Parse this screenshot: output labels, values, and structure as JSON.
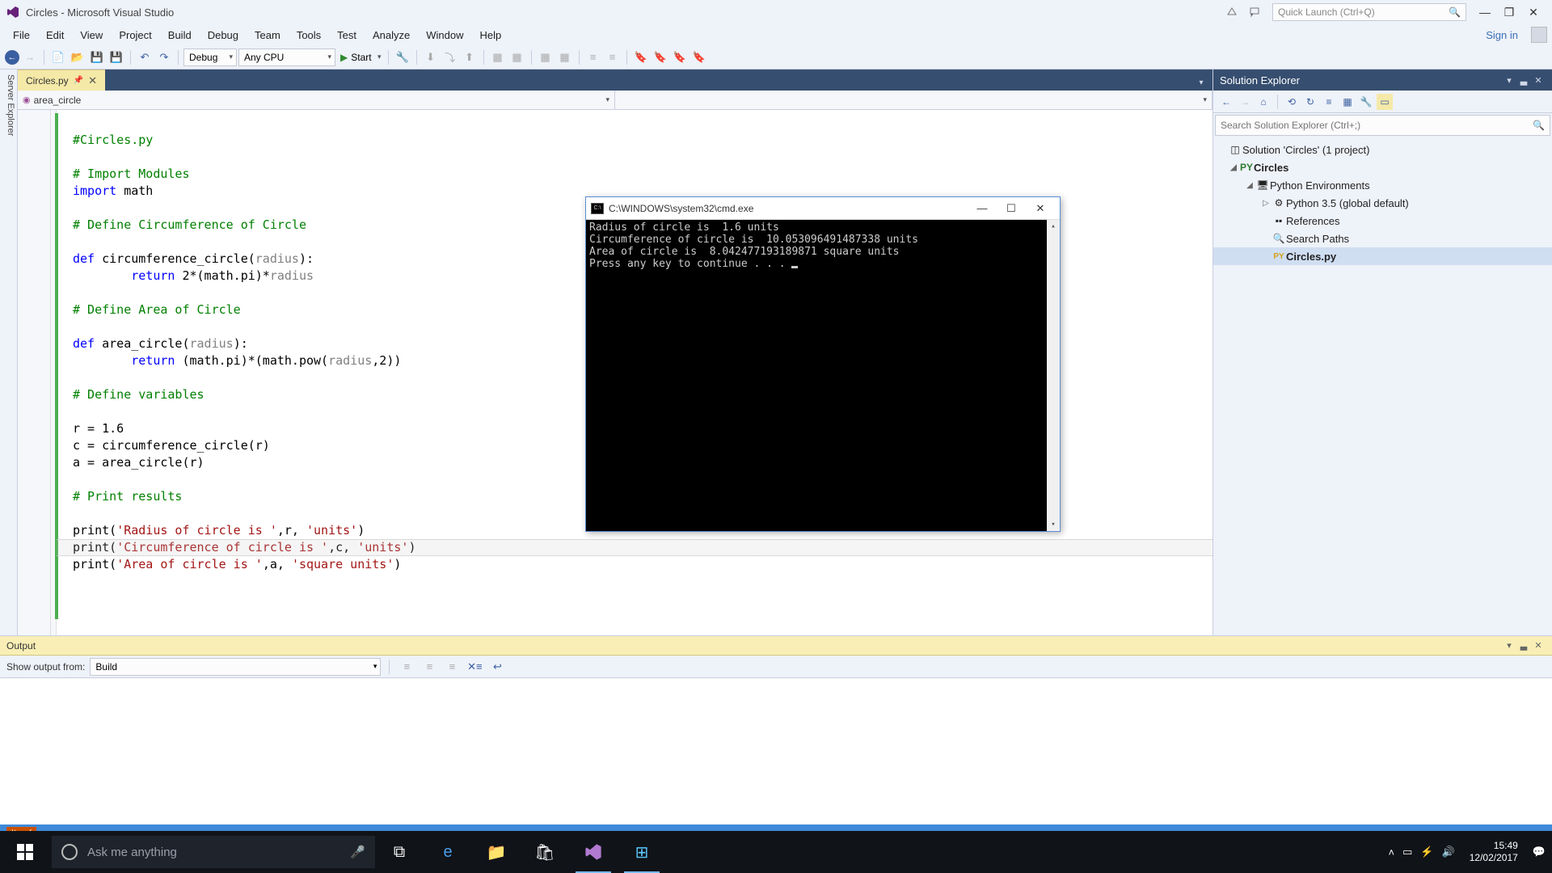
{
  "titlebar": {
    "title": "Circles - Microsoft Visual Studio"
  },
  "quicklaunch": {
    "placeholder": "Quick Launch (Ctrl+Q)"
  },
  "menu": {
    "items": [
      "File",
      "Edit",
      "View",
      "Project",
      "Build",
      "Debug",
      "Team",
      "Tools",
      "Test",
      "Analyze",
      "Window",
      "Help"
    ],
    "signin": "Sign in"
  },
  "toolbar": {
    "config": "Debug",
    "platform": "Any CPU",
    "start": "Start"
  },
  "tabs": {
    "active": "Circles.py"
  },
  "nav": {
    "left": "area_circle"
  },
  "code": {
    "l1": "#Circles.py",
    "l2": "# Import Modules",
    "l3a": "import",
    "l3b": " math",
    "l4": "# Define Circumference of Circle",
    "l5a": "def",
    "l5b": " circumference_circle(",
    "l5c": "radius",
    "l5d": "):",
    "l6a": "return",
    "l6b": " 2*(math.pi)*",
    "l6c": "radius",
    "l7": "# Define Area of Circle",
    "l8a": "def",
    "l8b": " area_circle(",
    "l8c": "radius",
    "l8d": "):",
    "l9a": "return",
    "l9b": " (math.pi)*(math.pow(",
    "l9c": "radius",
    "l9d": ",2))",
    "l10": "# Define variables",
    "l11": "r = 1.6",
    "l12": "c = circumference_circle(r)",
    "l13": "a = area_circle(r)",
    "l14": "# Print results",
    "l15a": "print(",
    "l15b": "'Radius of circle is '",
    "l15c": ",r, ",
    "l15d": "'units'",
    "l15e": ")",
    "l16a": "print(",
    "l16b": "'Circumference of circle is '",
    "l16c": ",c, ",
    "l16d": "'units'",
    "l16e": ")",
    "l17a": "print(",
    "l17b": "'Area of circle is '",
    "l17c": ",a, ",
    "l17d": "'square units'",
    "l17e": ")"
  },
  "solution": {
    "title": "Solution Explorer",
    "search": "Search Solution Explorer (Ctrl+;)",
    "root": "Solution 'Circles' (1 project)",
    "project": "Circles",
    "pyenv": "Python Environments",
    "pyver": "Python 3.5 (global default)",
    "refs": "References",
    "search_paths": "Search Paths",
    "file": "Circles.py"
  },
  "output": {
    "title": "Output",
    "show_from": "Show output from:",
    "source": "Build"
  },
  "console": {
    "title": "C:\\WINDOWS\\system32\\cmd.exe",
    "l1": "Radius of circle is  1.6 units",
    "l2": "Circumference of circle is  10.053096491487338 units",
    "l3": "Area of circle is  8.042477193189871 square units",
    "l4": "Press any key to continue . . . "
  },
  "status": {
    "text": "Item("
  },
  "taskbar": {
    "cortana": "Ask me anything",
    "time": "15:49",
    "date": "12/02/2017"
  }
}
